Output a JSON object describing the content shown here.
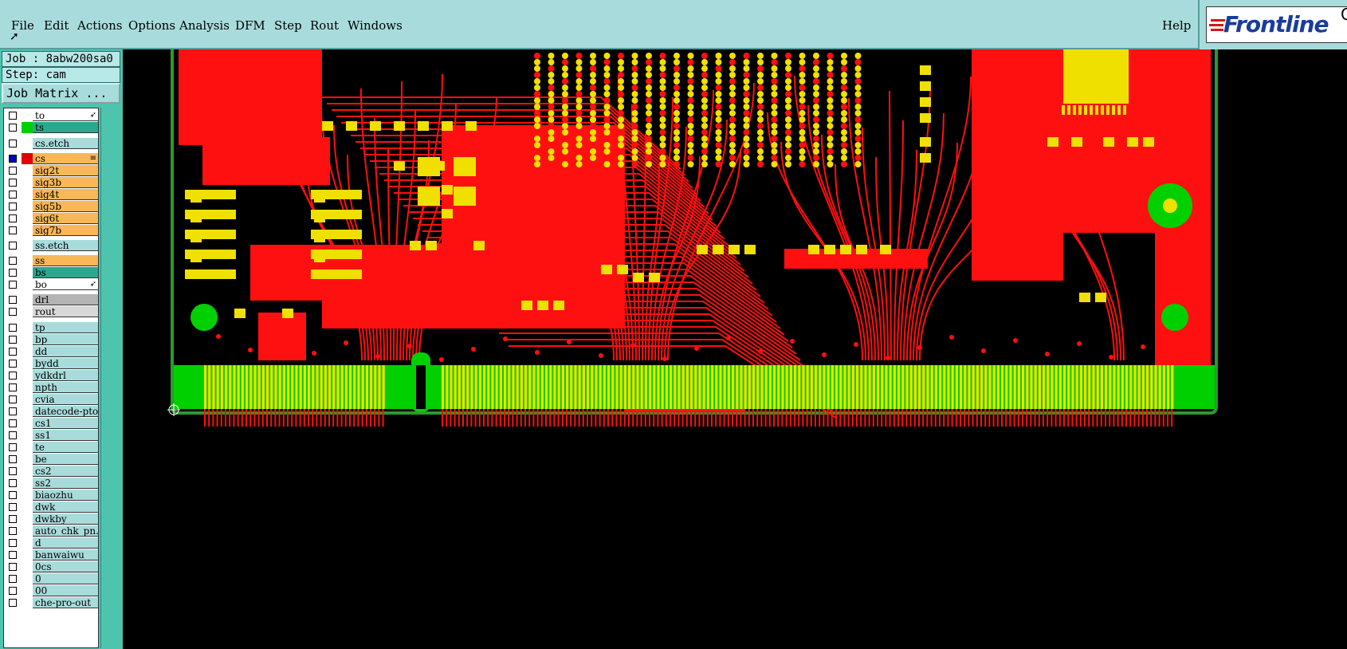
{
  "menu": {
    "items": [
      "File",
      "Edit",
      "Actions",
      "Options",
      "Analysis",
      "DFM",
      "Step",
      "Rout",
      "Windows"
    ],
    "help": "Help"
  },
  "logo": {
    "text": "Frontline",
    "suffix": "G"
  },
  "job": {
    "job_label": "Job : 8abw200sa0",
    "step_label": "Step: cam",
    "matrix_button": "Job Matrix ..."
  },
  "layers": [
    {
      "name": "to",
      "color": "#ffffff",
      "swatch": "#ffffff",
      "marker": true
    },
    {
      "name": "ts",
      "color": "#2aa88e",
      "swatch": "#00d000"
    },
    {
      "name": "cs.etch",
      "color": "#a8dcdc",
      "swatch": "#ffffff"
    },
    {
      "name": "cs",
      "color": "#f8b858",
      "swatch": "#e00000",
      "checked": true,
      "marker2": true
    },
    {
      "name": "sig2t",
      "color": "#f8b858",
      "swatch": "#ffffff"
    },
    {
      "name": "sig3b",
      "color": "#f8b858",
      "swatch": "#ffffff"
    },
    {
      "name": "sig4t",
      "color": "#f8b858",
      "swatch": "#ffffff"
    },
    {
      "name": "sig5b",
      "color": "#f8b858",
      "swatch": "#ffffff"
    },
    {
      "name": "sig6t",
      "color": "#f8b858",
      "swatch": "#ffffff"
    },
    {
      "name": "sig7b",
      "color": "#f8b858",
      "swatch": "#ffffff"
    },
    {
      "name": "ss.etch",
      "color": "#a8dcdc",
      "swatch": "#ffffff"
    },
    {
      "name": "ss",
      "color": "#f8b858",
      "swatch": "#ffffff"
    },
    {
      "name": "bs",
      "color": "#2aa88e",
      "swatch": "#ffffff"
    },
    {
      "name": "bo",
      "color": "#ffffff",
      "swatch": "#ffffff",
      "marker": true
    },
    {
      "name": "drl",
      "color": "#b4b4b4",
      "swatch": "#ffffff"
    },
    {
      "name": "rout",
      "color": "#d8d8d8",
      "swatch": "#ffffff"
    },
    {
      "name": "tp",
      "color": "#a8dcdc",
      "swatch": "#ffffff"
    },
    {
      "name": "bp",
      "color": "#a8dcdc",
      "swatch": "#ffffff"
    },
    {
      "name": "dd",
      "color": "#a8dcdc",
      "swatch": "#ffffff"
    },
    {
      "name": "bydd",
      "color": "#a8dcdc",
      "swatch": "#ffffff"
    },
    {
      "name": "ydkdrl",
      "color": "#a8dcdc",
      "swatch": "#ffffff"
    },
    {
      "name": "npth",
      "color": "#a8dcdc",
      "swatch": "#ffffff"
    },
    {
      "name": "cvia",
      "color": "#a8dcdc",
      "swatch": "#ffffff"
    },
    {
      "name": "datecode-pto",
      "color": "#a8dcdc",
      "swatch": "#ffffff"
    },
    {
      "name": "cs1",
      "color": "#a8dcdc",
      "swatch": "#ffffff"
    },
    {
      "name": "ss1",
      "color": "#a8dcdc",
      "swatch": "#ffffff"
    },
    {
      "name": "te",
      "color": "#a8dcdc",
      "swatch": "#ffffff"
    },
    {
      "name": "be",
      "color": "#a8dcdc",
      "swatch": "#ffffff"
    },
    {
      "name": "cs2",
      "color": "#a8dcdc",
      "swatch": "#ffffff"
    },
    {
      "name": "ss2",
      "color": "#a8dcdc",
      "swatch": "#ffffff"
    },
    {
      "name": "biaozhu",
      "color": "#a8dcdc",
      "swatch": "#ffffff"
    },
    {
      "name": "dwk",
      "color": "#a8dcdc",
      "swatch": "#ffffff"
    },
    {
      "name": "dwkby",
      "color": "#a8dcdc",
      "swatch": "#ffffff"
    },
    {
      "name": "auto_chk_pn...",
      "color": "#a8dcdc",
      "swatch": "#ffffff"
    },
    {
      "name": "d",
      "color": "#a8dcdc",
      "swatch": "#ffffff"
    },
    {
      "name": "banwaiwu",
      "color": "#a8dcdc",
      "swatch": "#ffffff"
    },
    {
      "name": "0cs",
      "color": "#a8dcdc",
      "swatch": "#ffffff"
    },
    {
      "name": "0",
      "color": "#a8dcdc",
      "swatch": "#ffffff"
    },
    {
      "name": "00",
      "color": "#a8dcdc",
      "swatch": "#ffffff"
    },
    {
      "name": "che-pro-out",
      "color": "#a8dcdc",
      "swatch": "#ffffff"
    }
  ],
  "colors": {
    "copper": "#ff1010",
    "pad": "#f0e000",
    "mask": "#00d000",
    "outline": "#2a9a2a",
    "background": "#000000"
  }
}
